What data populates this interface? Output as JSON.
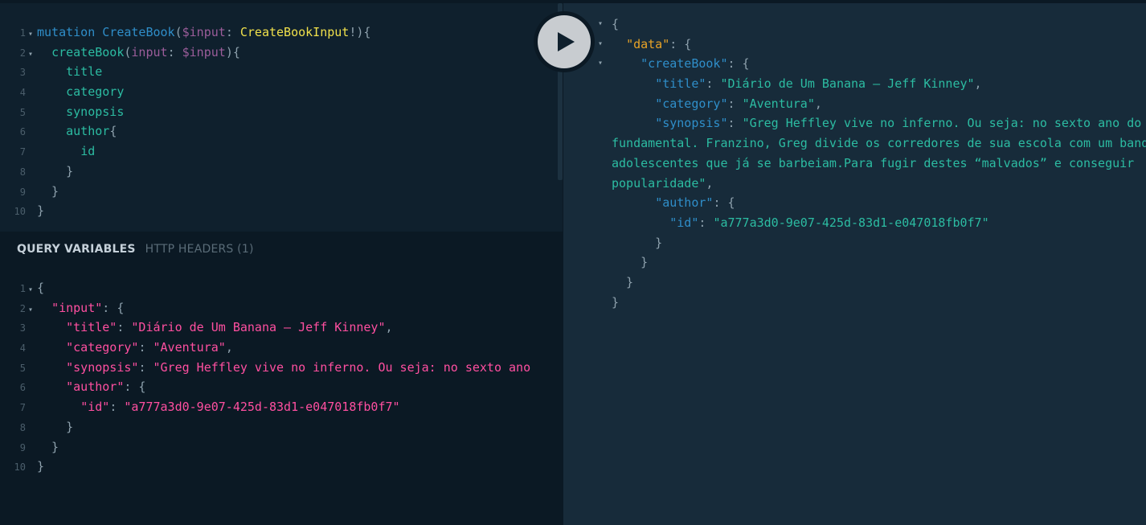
{
  "query_editor": {
    "lines": [
      {
        "n": "1",
        "arrow": true,
        "tokens": [
          [
            "kw",
            "mutation "
          ],
          [
            "def",
            "CreateBook"
          ],
          [
            "punct",
            "("
          ],
          [
            "var",
            "$input"
          ],
          [
            "punct",
            ": "
          ],
          [
            "type",
            "CreateBookInput"
          ],
          [
            "punct",
            "!){"
          ]
        ]
      },
      {
        "n": "2",
        "arrow": true,
        "tokens": [
          [
            "punct",
            "  "
          ],
          [
            "field",
            "createBook"
          ],
          [
            "punct",
            "("
          ],
          [
            "var",
            "input"
          ],
          [
            "punct",
            ": "
          ],
          [
            "var",
            "$input"
          ],
          [
            "punct",
            "){"
          ]
        ]
      },
      {
        "n": "3",
        "arrow": false,
        "tokens": [
          [
            "punct",
            "    "
          ],
          [
            "field",
            "title"
          ]
        ]
      },
      {
        "n": "4",
        "arrow": false,
        "tokens": [
          [
            "punct",
            "    "
          ],
          [
            "field",
            "category"
          ]
        ]
      },
      {
        "n": "5",
        "arrow": false,
        "tokens": [
          [
            "punct",
            "    "
          ],
          [
            "field",
            "synopsis"
          ]
        ]
      },
      {
        "n": "6",
        "arrow": false,
        "tokens": [
          [
            "punct",
            "    "
          ],
          [
            "field",
            "author"
          ],
          [
            "punct",
            "{"
          ]
        ]
      },
      {
        "n": "7",
        "arrow": false,
        "tokens": [
          [
            "punct",
            "      "
          ],
          [
            "field",
            "id"
          ]
        ]
      },
      {
        "n": "8",
        "arrow": false,
        "tokens": [
          [
            "punct",
            "    }"
          ]
        ]
      },
      {
        "n": "9",
        "arrow": false,
        "tokens": [
          [
            "punct",
            "  }"
          ]
        ]
      },
      {
        "n": "10",
        "arrow": false,
        "tokens": [
          [
            "punct",
            "}"
          ]
        ]
      }
    ]
  },
  "vars_pane": {
    "tab_query_variables": "QUERY VARIABLES",
    "tab_http_headers": "HTTP HEADERS (1)",
    "lines": [
      {
        "n": "1",
        "arrow": true,
        "tokens": [
          [
            "punct",
            "{"
          ]
        ]
      },
      {
        "n": "2",
        "arrow": true,
        "tokens": [
          [
            "punct",
            "  "
          ],
          [
            "key",
            "\"input\""
          ],
          [
            "punct",
            ": {"
          ]
        ]
      },
      {
        "n": "3",
        "arrow": false,
        "tokens": [
          [
            "punct",
            "    "
          ],
          [
            "key",
            "\"title\""
          ],
          [
            "punct",
            ": "
          ],
          [
            "str-q",
            "\"Diário de Um Banana – Jeff Kinney\""
          ],
          [
            "punct",
            ","
          ]
        ]
      },
      {
        "n": "4",
        "arrow": false,
        "tokens": [
          [
            "punct",
            "    "
          ],
          [
            "key",
            "\"category\""
          ],
          [
            "punct",
            ": "
          ],
          [
            "str-q",
            "\"Aventura\""
          ],
          [
            "punct",
            ","
          ]
        ]
      },
      {
        "n": "5",
        "arrow": false,
        "tokens": [
          [
            "punct",
            "    "
          ],
          [
            "key",
            "\"synopsis\""
          ],
          [
            "punct",
            ": "
          ],
          [
            "str-q",
            "\"Greg Heffley vive no inferno. Ou seja: no sexto ano"
          ]
        ]
      },
      {
        "n": "6",
        "arrow": false,
        "tokens": [
          [
            "punct",
            "    "
          ],
          [
            "key",
            "\"author\""
          ],
          [
            "punct",
            ": {"
          ]
        ]
      },
      {
        "n": "7",
        "arrow": false,
        "tokens": [
          [
            "punct",
            "      "
          ],
          [
            "key",
            "\"id\""
          ],
          [
            "punct",
            ": "
          ],
          [
            "str-q",
            "\"a777a3d0-9e07-425d-83d1-e047018fb0f7\""
          ]
        ]
      },
      {
        "n": "8",
        "arrow": false,
        "tokens": [
          [
            "punct",
            "    }"
          ]
        ]
      },
      {
        "n": "9",
        "arrow": false,
        "tokens": [
          [
            "punct",
            "  }"
          ]
        ]
      },
      {
        "n": "10",
        "arrow": false,
        "tokens": [
          [
            "punct",
            "}"
          ]
        ]
      }
    ]
  },
  "result_pane": {
    "lines": [
      {
        "arrow": true,
        "tokens": [
          [
            "punct",
            "{"
          ]
        ]
      },
      {
        "arrow": true,
        "tokens": [
          [
            "punct",
            "  "
          ],
          [
            "rkey-data",
            "\"data\""
          ],
          [
            "punct",
            ": {"
          ]
        ]
      },
      {
        "arrow": true,
        "tokens": [
          [
            "punct",
            "    "
          ],
          [
            "rkey",
            "\"createBook\""
          ],
          [
            "punct",
            ": {"
          ]
        ]
      },
      {
        "arrow": false,
        "tokens": [
          [
            "punct",
            "      "
          ],
          [
            "rkey",
            "\"title\""
          ],
          [
            "punct",
            ": "
          ],
          [
            "rstr",
            "\"Diário de Um Banana – Jeff Kinney\""
          ],
          [
            "punct",
            ","
          ]
        ]
      },
      {
        "arrow": false,
        "tokens": [
          [
            "punct",
            "      "
          ],
          [
            "rkey",
            "\"category\""
          ],
          [
            "punct",
            ": "
          ],
          [
            "rstr",
            "\"Aventura\""
          ],
          [
            "punct",
            ","
          ]
        ]
      },
      {
        "arrow": false,
        "tokens": [
          [
            "punct",
            "      "
          ],
          [
            "rkey",
            "\"synopsis\""
          ],
          [
            "punct",
            ": "
          ],
          [
            "rstr",
            "\"Greg Heffley vive no inferno. Ou seja: no sexto ano do ensino"
          ]
        ]
      },
      {
        "arrow": false,
        "tokens": [
          [
            "rstr",
            "fundamental. Franzino, Greg divide os corredores de sua escola com um bando de"
          ]
        ]
      },
      {
        "arrow": false,
        "tokens": [
          [
            "rstr",
            "adolescentes que já se barbeiam.Para fugir destes “malvados” e conseguir"
          ]
        ]
      },
      {
        "arrow": false,
        "tokens": [
          [
            "rstr",
            "popularidade\""
          ],
          [
            "punct",
            ","
          ]
        ]
      },
      {
        "arrow": false,
        "tokens": [
          [
            "punct",
            "      "
          ],
          [
            "rkey",
            "\"author\""
          ],
          [
            "punct",
            ": {"
          ]
        ]
      },
      {
        "arrow": false,
        "tokens": [
          [
            "punct",
            "        "
          ],
          [
            "rkey",
            "\"id\""
          ],
          [
            "punct",
            ": "
          ],
          [
            "rstr",
            "\"a777a3d0-9e07-425d-83d1-e047018fb0f7\""
          ]
        ]
      },
      {
        "arrow": false,
        "tokens": [
          [
            "punct",
            "      }"
          ]
        ]
      },
      {
        "arrow": false,
        "tokens": [
          [
            "punct",
            "    }"
          ]
        ]
      },
      {
        "arrow": false,
        "tokens": [
          [
            "punct",
            "  }"
          ]
        ]
      },
      {
        "arrow": false,
        "tokens": [
          [
            "punct",
            "}"
          ]
        ]
      }
    ]
  },
  "play_button": {
    "icon": "play-icon"
  },
  "fold_arrow_glyph": "▾"
}
